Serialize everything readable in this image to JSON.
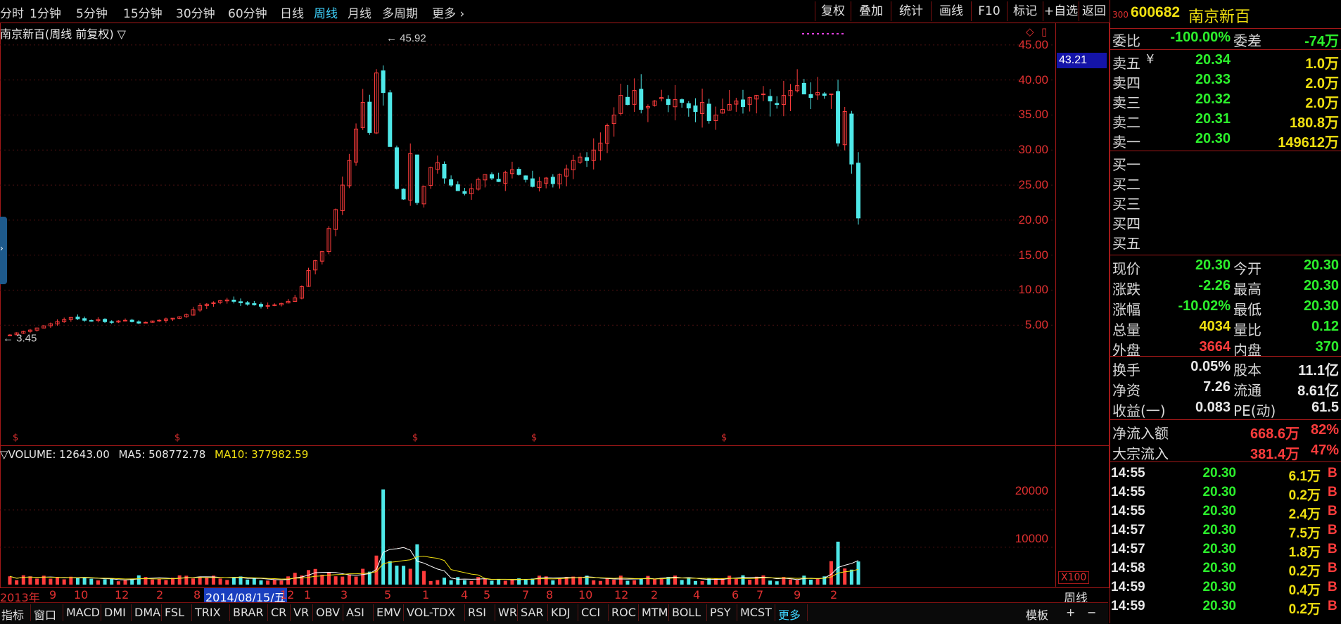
{
  "periods": [
    "分时",
    "1分钟",
    "5分钟",
    "15分钟",
    "30分钟",
    "60分钟",
    "日线",
    "周线",
    "月线",
    "多周期",
    "更多"
  ],
  "active_period": "周线",
  "tools": [
    "复权",
    "叠加",
    "统计",
    "画线",
    "F10",
    "标记",
    "+自选",
    "返回"
  ],
  "chart": {
    "title": "南京新百(周线 前复权)",
    "high_label": "45.92",
    "low_label": "3.45",
    "current_price_tag": "43.21",
    "y_ticks": [
      "45.00",
      "40.00",
      "35.00",
      "30.00",
      "25.00",
      "20.00",
      "15.00",
      "10.00",
      "5.00"
    ],
    "x_labels": [
      "2013年",
      "9",
      "10",
      "12",
      "2",
      "8",
      "2014/08/15/五",
      "12",
      "1",
      "3",
      "5",
      "1",
      "4",
      "5",
      "7",
      "8",
      "10",
      "12",
      "2",
      "4",
      "6",
      "7",
      "9",
      "2"
    ],
    "period_label": "周线"
  },
  "chart_data": {
    "type": "candlestick",
    "title": "南京新百(周线 前复权)",
    "ylim": [
      0,
      47
    ],
    "high": 45.92,
    "low": 3.45,
    "closes": [
      3.6,
      3.9,
      4.1,
      4.3,
      4.6,
      4.9,
      5.2,
      5.5,
      5.8,
      6.1,
      5.9,
      5.7,
      5.6,
      5.8,
      5.5,
      5.4,
      5.6,
      5.7,
      5.5,
      5.3,
      5.4,
      5.6,
      5.7,
      5.9,
      6.0,
      6.2,
      6.5,
      7.2,
      7.8,
      8.0,
      8.2,
      8.5,
      8.6,
      8.4,
      8.2,
      8.0,
      7.9,
      7.7,
      7.8,
      7.9,
      8.1,
      8.4,
      8.9,
      10.5,
      12.8,
      14.2,
      15.5,
      18.8,
      21.5,
      25.0,
      28.5,
      33.0,
      36.8,
      32.5,
      41.0,
      38.2,
      30.5,
      24.5,
      23.0,
      29.5,
      22.5,
      24.8,
      27.5,
      28.2,
      26.0,
      25.0,
      24.2,
      23.8,
      24.5,
      25.8,
      26.5,
      26.0,
      25.5,
      26.8,
      27.2,
      26.5,
      25.8,
      24.8,
      25.5,
      26.0,
      25.2,
      26.5,
      27.3,
      28.5,
      29.0,
      28.5,
      30.0,
      31.0,
      33.5,
      35.0,
      37.8,
      36.5,
      38.5,
      35.8,
      36.2,
      37.0,
      37.5,
      36.5,
      37.2,
      36.8,
      36.0,
      35.5,
      36.8,
      34.2,
      35.0,
      35.8,
      36.5,
      37.0,
      36.2,
      37.5,
      37.8,
      38.0,
      37.0,
      36.5,
      37.8,
      38.5,
      39.2,
      38.0,
      37.5,
      38.2,
      37.8,
      38.0,
      31.0,
      35.5,
      28.0,
      20.3
    ],
    "volume": {
      "label": "VOLUME: 12643.00",
      "ma5_label": "MA5: 508772.78",
      "ma10_label": "MA10: 377982.59",
      "ticks": [
        "20000",
        "10000"
      ],
      "unit": "X100"
    }
  },
  "quote": {
    "code_prefix": "300",
    "code": "600682",
    "name": "南京新百",
    "weibi_label": "委比",
    "weibi": "-100.00%",
    "weicha_label": "委差",
    "weicha": "-74万",
    "asks": [
      {
        "label": "卖五",
        "price": "20.34",
        "vol": "1.0万"
      },
      {
        "label": "卖四",
        "price": "20.33",
        "vol": "2.0万"
      },
      {
        "label": "卖三",
        "price": "20.32",
        "vol": "2.0万"
      },
      {
        "label": "卖二",
        "price": "20.31",
        "vol": "180.8万"
      },
      {
        "label": "卖一",
        "price": "20.30",
        "vol": "149612万"
      }
    ],
    "bids": [
      "买一",
      "买二",
      "买三",
      "买四",
      "买五"
    ],
    "stats": [
      {
        "l1": "现价",
        "v1": "20.30",
        "l2": "今开",
        "v2": "20.30"
      },
      {
        "l1": "涨跌",
        "v1": "-2.26",
        "l2": "最高",
        "v2": "20.30"
      },
      {
        "l1": "涨幅",
        "v1": "-10.02%",
        "l2": "最低",
        "v2": "20.30"
      },
      {
        "l1": "总量",
        "v1": "4034",
        "l2": "量比",
        "v2": "0.12"
      },
      {
        "l1": "外盘",
        "v1": "3664",
        "l2": "内盘",
        "v2": "370"
      }
    ],
    "fund": [
      {
        "l1": "换手",
        "v1": "0.05%",
        "l2": "股本",
        "v2": "11.1亿"
      },
      {
        "l1": "净资",
        "v1": "7.26",
        "l2": "流通",
        "v2": "8.61亿"
      },
      {
        "l1": "收益(一)",
        "v1": "0.083",
        "l2": "PE(动)",
        "v2": "61.5"
      }
    ],
    "flow": [
      {
        "label": "净流入额",
        "amt": "668.6万",
        "pct": "82%"
      },
      {
        "label": "大宗流入",
        "amt": "381.4万",
        "pct": "47%"
      }
    ],
    "ticks": [
      {
        "time": "14:55",
        "price": "20.30",
        "vol": "6.1万",
        "side": "B"
      },
      {
        "time": "14:55",
        "price": "20.30",
        "vol": "0.2万",
        "side": "B"
      },
      {
        "time": "14:55",
        "price": "20.30",
        "vol": "2.4万",
        "side": "B"
      },
      {
        "time": "14:57",
        "price": "20.30",
        "vol": "7.5万",
        "side": "B"
      },
      {
        "time": "14:57",
        "price": "20.30",
        "vol": "1.8万",
        "side": "B"
      },
      {
        "time": "14:58",
        "price": "20.30",
        "vol": "0.2万",
        "side": "B"
      },
      {
        "time": "14:59",
        "price": "20.30",
        "vol": "0.4万",
        "side": "B"
      },
      {
        "time": "14:59",
        "price": "20.30",
        "vol": "0.2万",
        "side": "B"
      }
    ]
  },
  "indicator_tabs": [
    "指标",
    "窗口",
    "MACD",
    "DMI",
    "DMA",
    "FSL",
    "TRIX",
    "BRAR",
    "CR",
    "VR",
    "OBV",
    "ASI",
    "EMV",
    "VOL-TDX",
    "RSI",
    "WR",
    "SAR",
    "KDJ",
    "CCI",
    "ROC",
    "MTM",
    "BOLL",
    "PSY",
    "MCST",
    "更多"
  ],
  "active_indicator": "更多",
  "template_btn": "模板",
  "plus_btn": "+",
  "minus_btn": "−",
  "colors": {
    "up": "#ff3c3c",
    "down": "#4ee8e8",
    "ma5": "#ffffff",
    "ma10": "#f0e010",
    "frame": "#a31818"
  }
}
